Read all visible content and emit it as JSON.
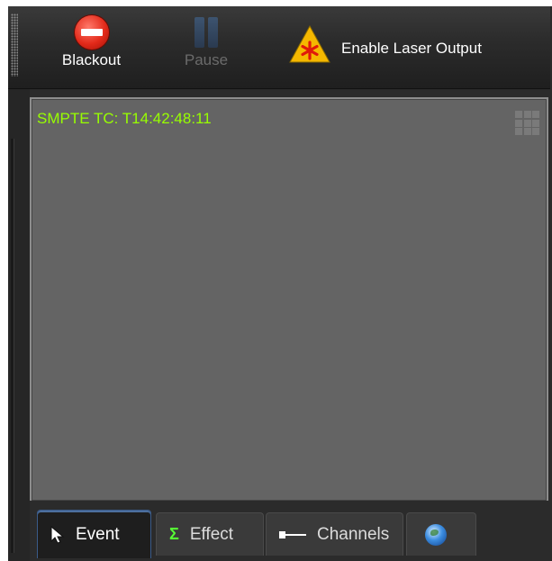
{
  "toolbar": {
    "blackout_label": "Blackout",
    "pause_label": "Pause",
    "laser_label": "Enable Laser Output"
  },
  "preview": {
    "timecode": "SMPTE TC: T14:42:48:11"
  },
  "tabs": [
    {
      "label": "Event",
      "icon": "cursor-arrow-icon",
      "active": true
    },
    {
      "label": "Effect",
      "icon": "sigma-icon",
      "active": false
    },
    {
      "label": "Channels",
      "icon": "channels-icon",
      "active": false
    },
    {
      "label": "",
      "icon": "globe-icon",
      "active": false
    }
  ],
  "colors": {
    "timecode": "#98ff00",
    "panel_background": "#646464",
    "toolbar_background": "#2c2c2c",
    "blackout": "#e32a1a",
    "warning": "#f5b800"
  }
}
